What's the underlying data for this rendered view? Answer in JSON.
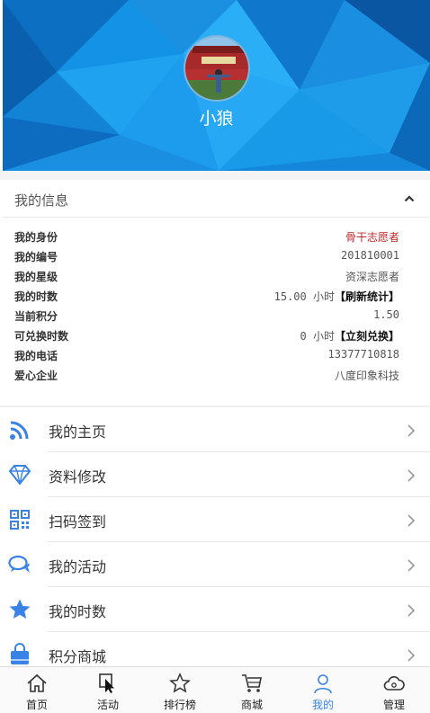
{
  "profile": {
    "username": "小狼"
  },
  "info": {
    "title": "我的信息",
    "rows": [
      {
        "label": "我的身份",
        "value": "骨干志愿者"
      },
      {
        "label": "我的编号",
        "value": "201810001"
      },
      {
        "label": "我的星级",
        "value": "资深志愿者"
      },
      {
        "label": "我的时数",
        "value": "15.00 小时",
        "action": "【刷新统计】"
      },
      {
        "label": "当前积分",
        "value": "1.50"
      },
      {
        "label": "可兑换时数",
        "value": "0 小时",
        "action": "【立刻兑换】"
      },
      {
        "label": "我的电话",
        "value": "13377710818"
      },
      {
        "label": "爱心企业",
        "value": "八度印象科技"
      }
    ]
  },
  "menu": {
    "items": [
      {
        "label": "我的主页",
        "icon": "rss-icon"
      },
      {
        "label": "资料修改",
        "icon": "diamond-icon"
      },
      {
        "label": "扫码签到",
        "icon": "qrcode-icon"
      },
      {
        "label": "我的活动",
        "icon": "chat-bubbles-icon"
      },
      {
        "label": "我的时数",
        "icon": "star-icon"
      },
      {
        "label": "积分商城",
        "icon": "shopping-bag-icon"
      }
    ]
  },
  "tabbar": {
    "tabs": [
      {
        "label": "首页",
        "icon": "home-icon"
      },
      {
        "label": "活动",
        "icon": "pointer-icon"
      },
      {
        "label": "排行榜",
        "icon": "star-outline-icon"
      },
      {
        "label": "商城",
        "icon": "cart-icon"
      },
      {
        "label": "我的",
        "icon": "person-icon",
        "active": true
      },
      {
        "label": "管理",
        "icon": "cloud-icon"
      }
    ]
  },
  "colors": {
    "banner": "#1493e6",
    "accent": "#3a82e6",
    "identity": "#c0282b"
  }
}
